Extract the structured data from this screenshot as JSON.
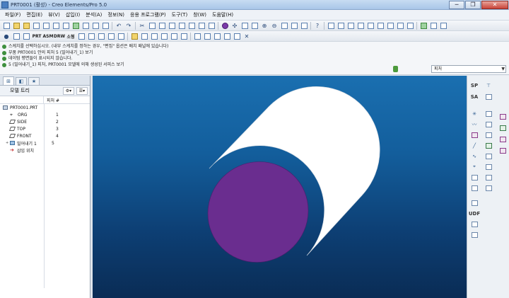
{
  "window": {
    "title": "PRT0001 (활성) - Creo Elements/Pro 5.0",
    "buttons": [
      "─",
      "❐",
      "✕"
    ]
  },
  "menubar": [
    "파일(F)",
    "편집(E)",
    "뷰(V)",
    "삽입(I)",
    "분석(A)",
    "정보(N)",
    "응용 프로그램(P)",
    "도구(T)",
    "창(W)",
    "도움말(H)"
  ],
  "toolbar_row2_text_buttons": {
    "prt": "PRT",
    "asm": "ASM",
    "drw": "DRW",
    "small": "소형"
  },
  "messages": [
    {
      "icon": "info-icon",
      "text": "스케치를 선택하십시오. (내부 스케치를 정하는 경우, \"편집\" 옵션은 배치 패널에 있습니다)"
    },
    {
      "icon": "info-icon",
      "text": "부품 PRT0001 안의 피처 5 (밀어내기_1) 보기"
    },
    {
      "icon": "info-icon",
      "text": "데이텀 평면들이 표시되지 않습니다."
    },
    {
      "icon": "info-icon",
      "text": "5 (밀어내기_1) 피처, PRT0001 모델에 의해 생성된 서피스 보기"
    }
  ],
  "filter": {
    "value": "피처",
    "arrow": "▼"
  },
  "model_tree": {
    "header": "모델 트리",
    "column_header": "피처 #",
    "rows": [
      {
        "icon": "part-icon",
        "name": "PRT0001.PRT",
        "num": ""
      },
      {
        "icon": "csys-icon",
        "name": "ORG",
        "num": "1"
      },
      {
        "icon": "datum-plane-icon",
        "name": "SIDE",
        "num": "2"
      },
      {
        "icon": "datum-plane-icon",
        "name": "TOP",
        "num": "3"
      },
      {
        "icon": "datum-plane-icon",
        "name": "FRONT",
        "num": "4"
      },
      {
        "icon": "extrude-icon",
        "name": "밀어내기 1",
        "num": "5"
      },
      {
        "icon": "insert-here-icon",
        "name": "삽입 위치",
        "num": ""
      }
    ]
  },
  "right_toolbar_labels": {
    "sp": "SP",
    "sa": "SA",
    "udf": "UDF"
  },
  "colors": {
    "viewport_top": "#1a6fb0",
    "viewport_bottom": "#0a2c55",
    "cylinder_side": "#ffffff",
    "cylinder_face": "#6a2d8f"
  }
}
